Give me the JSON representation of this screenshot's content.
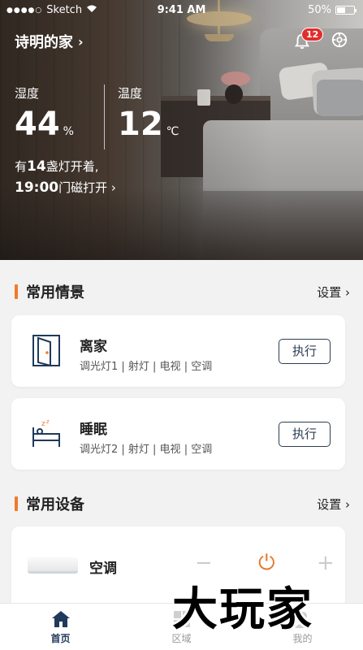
{
  "status_bar": {
    "signal_dots": "●●●●○",
    "carrier": "Sketch",
    "time": "9:41 AM",
    "battery": "50%",
    "battery_level": 0.5
  },
  "header": {
    "home_name": "诗明的家",
    "chevron": "›",
    "notification_count": "12",
    "icons": [
      "bell-icon",
      "settings-icon"
    ]
  },
  "environment": {
    "humidity_label": "湿度",
    "humidity_value": "44",
    "humidity_unit": "%",
    "temperature_label": "温度",
    "temperature_value": "12",
    "temperature_unit": "℃",
    "lights_prefix": "有",
    "lights_count": "14",
    "lights_suffix": "盏灯开着,",
    "door_time": "19:00",
    "door_text": "门磁打开 ›"
  },
  "scenes_section": {
    "title": "常用情景",
    "settings_label": "设置 ›",
    "accent": "#f07a2a",
    "scenes": [
      {
        "name": "离家",
        "devices": "调光灯1 | 射灯 | 电视 | 空调",
        "action": "执行",
        "icon": "door-exit-icon"
      },
      {
        "name": "睡眠",
        "devices": "调光灯2 | 射灯 | 电视 | 空调",
        "action": "执行",
        "icon": "sleep-bed-icon"
      }
    ]
  },
  "devices_section": {
    "title": "常用设备",
    "settings_label": "设置 ›",
    "devices": [
      {
        "name": "空调",
        "minus": "−",
        "power": "⏻",
        "plus": "+",
        "icon": "air-conditioner-icon"
      }
    ]
  },
  "tabbar": {
    "tabs": [
      {
        "label": "首页",
        "icon": "home-icon",
        "active": true
      },
      {
        "label": "区域",
        "icon": "grid-icon",
        "active": false
      },
      {
        "label": "我的",
        "icon": "user-icon",
        "active": false
      }
    ],
    "active_color": "#1f3a5a"
  },
  "watermark": "大玩家"
}
